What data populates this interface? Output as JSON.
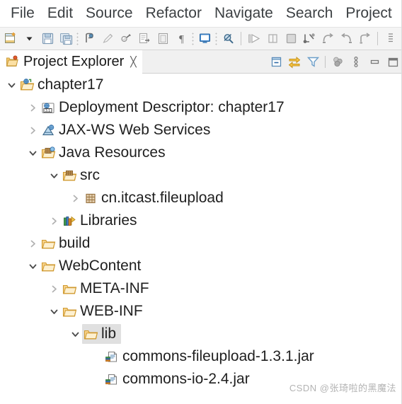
{
  "menubar": {
    "items": [
      {
        "label": "File"
      },
      {
        "label": "Edit"
      },
      {
        "label": "Source"
      },
      {
        "label": "Refactor"
      },
      {
        "label": "Navigate"
      },
      {
        "label": "Search"
      },
      {
        "label": "Project"
      }
    ]
  },
  "toolbar": {
    "buttons": [
      {
        "name": "new-wizard-icon",
        "title": "New"
      },
      {
        "name": "new-dropdown-arrow-icon",
        "title": "New dropdown"
      },
      {
        "name": "save-icon",
        "title": "Save"
      },
      {
        "name": "save-all-icon",
        "title": "Save All"
      },
      {
        "name": "print-icon",
        "title": "Print"
      },
      {
        "name": "pencil-icon",
        "title": "Edit"
      },
      {
        "name": "quick-fix-icon",
        "title": "Quick Fix"
      },
      {
        "name": "export-icon",
        "title": "Export"
      },
      {
        "name": "open-type-icon",
        "title": "Open Type"
      },
      {
        "name": "paragraph-mark-icon",
        "title": "Show Whitespace"
      },
      {
        "name": "open-perspective-icon",
        "title": "Open Perspective"
      },
      {
        "name": "search-disabled-icon",
        "title": "Search"
      },
      {
        "name": "run-icon",
        "title": "Run"
      },
      {
        "name": "pause-icon",
        "title": "Pause"
      },
      {
        "name": "stop-icon",
        "title": "Terminate"
      },
      {
        "name": "step-into-icon",
        "title": "Step Into"
      },
      {
        "name": "step-over-icon",
        "title": "Step Over"
      },
      {
        "name": "step-return-icon",
        "title": "Step Return"
      },
      {
        "name": "drop-to-frame-icon",
        "title": "Drop to Frame"
      },
      {
        "name": "toolbar-overflow-icon",
        "title": "More"
      }
    ]
  },
  "view": {
    "title": "Project Explorer",
    "close_glyph": "╳",
    "actions": [
      {
        "name": "collapse-all-icon",
        "title": "Collapse All"
      },
      {
        "name": "link-with-editor-icon",
        "title": "Link with Editor"
      },
      {
        "name": "view-filter-icon",
        "title": "Filters"
      },
      {
        "name": "focus-active-task-icon",
        "title": "Focus on Active Task"
      },
      {
        "name": "view-menu-icon",
        "title": "View Menu"
      },
      {
        "name": "minimize-icon",
        "title": "Minimize"
      },
      {
        "name": "maximize-icon",
        "title": "Maximize"
      }
    ]
  },
  "tree": {
    "nodes": [
      {
        "label": "chapter17",
        "depth": 0,
        "state": "expanded",
        "icon": "dynamic-web-project-icon",
        "selected": false
      },
      {
        "label": "Deployment Descriptor: chapter17",
        "depth": 1,
        "state": "collapsed",
        "icon": "deployment-descriptor-icon",
        "badge": "3.1",
        "selected": false
      },
      {
        "label": "JAX-WS Web Services",
        "depth": 1,
        "state": "collapsed",
        "icon": "jax-ws-icon",
        "selected": false
      },
      {
        "label": "Java Resources",
        "depth": 1,
        "state": "expanded",
        "icon": "java-resources-icon",
        "selected": false
      },
      {
        "label": "src",
        "depth": 2,
        "state": "expanded",
        "icon": "source-folder-icon",
        "selected": false
      },
      {
        "label": "cn.itcast.fileupload",
        "depth": 3,
        "state": "collapsed",
        "icon": "package-icon",
        "selected": false
      },
      {
        "label": "Libraries",
        "depth": 2,
        "state": "collapsed",
        "icon": "libraries-icon",
        "selected": false
      },
      {
        "label": "build",
        "depth": 1,
        "state": "collapsed",
        "icon": "folder-icon",
        "selected": false
      },
      {
        "label": "WebContent",
        "depth": 1,
        "state": "expanded",
        "icon": "folder-icon",
        "selected": false
      },
      {
        "label": "META-INF",
        "depth": 2,
        "state": "collapsed",
        "icon": "folder-icon",
        "selected": false
      },
      {
        "label": "WEB-INF",
        "depth": 2,
        "state": "expanded",
        "icon": "folder-icon",
        "selected": false
      },
      {
        "label": "lib",
        "depth": 3,
        "state": "expanded",
        "icon": "folder-icon",
        "selected": true
      },
      {
        "label": "commons-fileupload-1.3.1.jar",
        "depth": 4,
        "state": "leaf",
        "icon": "jar-icon",
        "selected": false
      },
      {
        "label": "commons-io-2.4.jar",
        "depth": 4,
        "state": "leaf",
        "icon": "jar-icon",
        "selected": false
      }
    ]
  },
  "watermark": {
    "text": "CSDN @张琦啦的黑魔法"
  },
  "colors": {
    "folder": "#f0bc5e",
    "selection": "#e0e0e0",
    "text": "#1f1f1f",
    "menu_text": "#3c4043",
    "toolbar_bg": "#f4f4f4"
  }
}
